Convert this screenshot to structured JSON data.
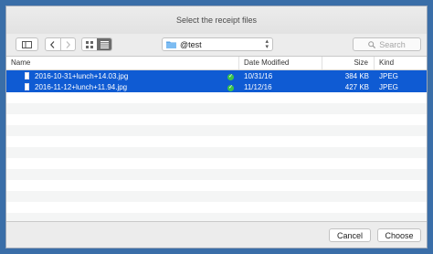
{
  "window": {
    "title": "Select the receipt files"
  },
  "toolbar": {
    "location": "@test",
    "search_placeholder": "Search"
  },
  "columns": {
    "name": "Name",
    "date": "Date Modified",
    "size": "Size",
    "kind": "Kind"
  },
  "files": [
    {
      "name": "2016-10-31+lunch+14.03.jpg",
      "date": "10/31/16",
      "size": "384 KB",
      "kind": "JPEG"
    },
    {
      "name": "2016-11-12+lunch+11.94.jpg",
      "date": "11/12/16",
      "size": "427 KB",
      "kind": "JPEG"
    }
  ],
  "footer": {
    "cancel": "Cancel",
    "choose": "Choose"
  },
  "colors": {
    "selection": "#0f5bd3",
    "tag": "#3cc44a",
    "desktop": "#3a6ea8"
  },
  "icons": [
    "sidebar-icon",
    "back-icon",
    "forward-icon",
    "grid-view-icon",
    "list-view-icon",
    "folder-icon",
    "search-icon",
    "file-icon",
    "green-tag-icon"
  ]
}
